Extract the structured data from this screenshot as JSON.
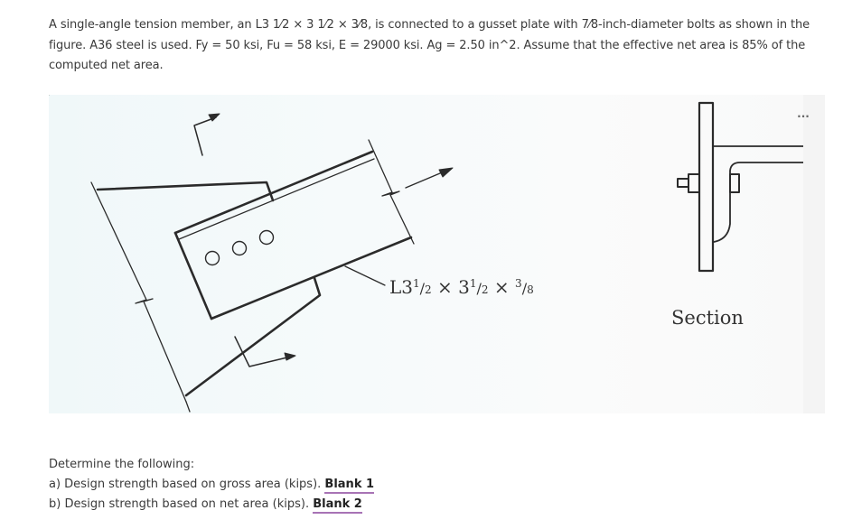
{
  "problem": {
    "statement": "A single-angle tension member, an L3 1⁄2 × 3 1⁄2 × 3⁄8, is connected to a gusset plate with 7⁄8-inch-diameter bolts as shown in the figure. A36 steel is used. Fy = 50 ksi, Fu = 58 ksi, E = 29000 ksi. Ag = 2.50 in^2. Assume that the effective net area is 85% of the computed net area."
  },
  "figure": {
    "more_icon": "more-horizontal-icon",
    "more_label": "...",
    "angle_label": {
      "prefix": "L3",
      "part1_num": "1",
      "part1_den": "2",
      "times1": " × 3",
      "part2_num": "1",
      "part2_den": "2",
      "times2": " × ",
      "part3_num": "3",
      "part3_den": "8"
    },
    "section_label": "Section",
    "bolt_count": 3
  },
  "questions": {
    "intro": "Determine the following:",
    "items": [
      {
        "text": "a) Design strength based on gross area (kips). ",
        "blank_label": "Blank 1"
      },
      {
        "text": "b) Design strength based on net area (kips). ",
        "blank_label": "Blank 2"
      }
    ]
  },
  "colors": {
    "blank_underline": "#a873b5",
    "line": "#2b2b2b"
  }
}
